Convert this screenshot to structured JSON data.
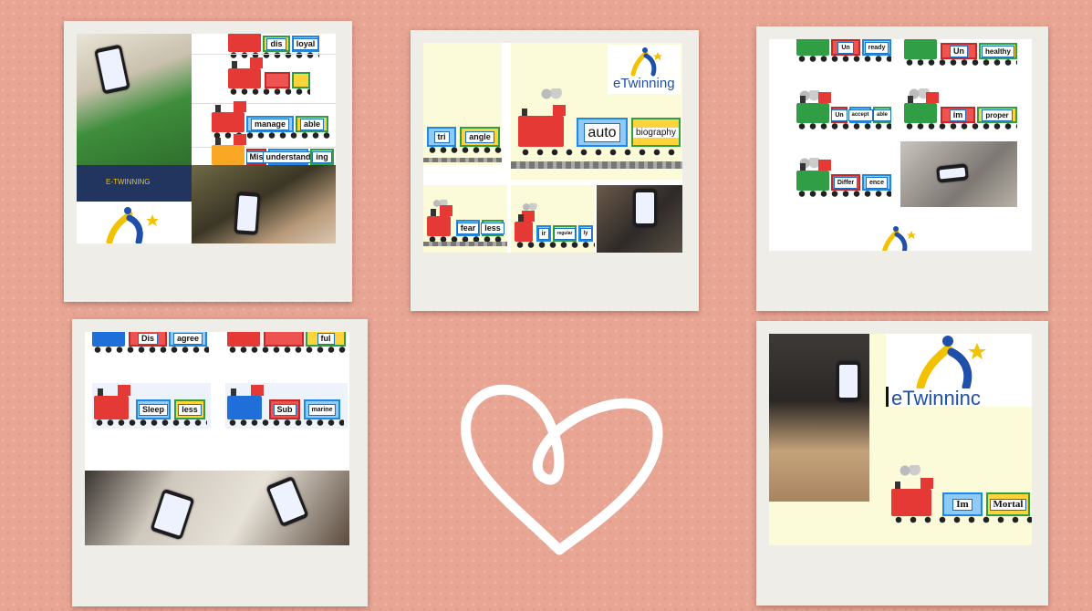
{
  "logo": {
    "brand": "eTwinning",
    "brand_banner": "E-TWINNING",
    "brand_cut": "eTwinninc"
  },
  "colors": {
    "background": "#e8a594",
    "frame": "#efede8",
    "cream": "#fbfbd9",
    "heart": "#ffffff",
    "logo_blue": "#1f4fa8",
    "logo_yellow": "#f2c200"
  },
  "collage1": {
    "trains": [
      {
        "words": [
          "dis",
          "loyal"
        ]
      },
      {
        "words": [
          "",
          ""
        ]
      },
      {
        "words": [
          "manage",
          "able"
        ]
      },
      {
        "words": [
          "Mis",
          "understand",
          "ing"
        ]
      }
    ]
  },
  "collage2": {
    "big_train": [
      "auto",
      "biography"
    ],
    "small_train_1": [
      "tri",
      "angle"
    ],
    "small_train_2": [
      "fear",
      "less"
    ],
    "small_train_3": [
      "ir",
      "regular",
      "ly"
    ]
  },
  "collage3": {
    "trains": [
      {
        "words": [
          "Un",
          "",
          "ready"
        ]
      },
      {
        "words": [
          "Un",
          "healthy"
        ]
      },
      {
        "words": [
          "Un",
          "accept",
          "able"
        ]
      },
      {
        "words": [
          "im",
          "proper"
        ]
      },
      {
        "words": [
          "Differ",
          "ence"
        ]
      }
    ]
  },
  "collage4": {
    "trains": [
      {
        "words": [
          "Dis",
          "agree"
        ]
      },
      {
        "words": [
          "",
          "ful"
        ]
      },
      {
        "words": [
          "Sleep",
          "less"
        ]
      },
      {
        "words": [
          "Sub",
          "marine"
        ]
      }
    ]
  },
  "collage5": {
    "train": [
      "Im",
      "Mortal"
    ]
  },
  "icons": [
    "heart-doodle-icon",
    "etwinning-logo-icon",
    "smartphone-icon",
    "locomotive-icon"
  ]
}
